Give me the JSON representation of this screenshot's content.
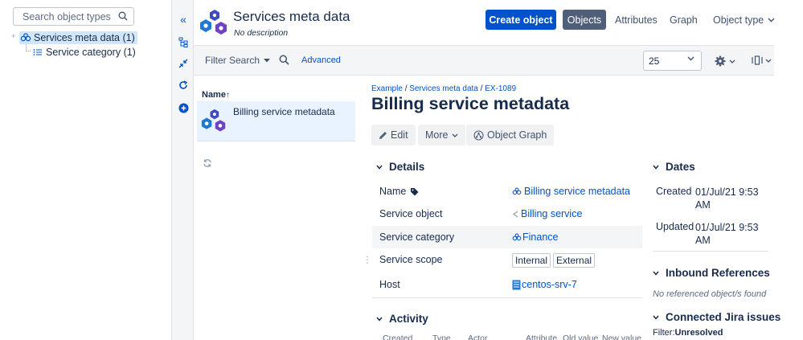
{
  "tree": {
    "search_placeholder": "Search object types",
    "nodes": [
      {
        "label": "Services meta data (1)"
      },
      {
        "label": "Service category (1)"
      }
    ]
  },
  "header": {
    "title": "Services meta data",
    "subtitle": "No description",
    "create_button": "Create object",
    "tabs": [
      "Objects",
      "Attributes",
      "Graph",
      "Object type"
    ]
  },
  "toolbar": {
    "filter_search": "Filter Search",
    "advanced": "Advanced",
    "page_size": "25"
  },
  "list": {
    "column": "Name",
    "rows": [
      {
        "label": "Billing service metadata"
      }
    ]
  },
  "detail": {
    "breadcrumb": [
      "Example",
      "Services meta data",
      "EX-1089"
    ],
    "title": "Billing service metadata",
    "actions": {
      "edit": "Edit",
      "more": "More",
      "graph": "Object Graph"
    },
    "details_heading": "Details",
    "attributes": [
      {
        "key": "Name",
        "value": "Billing service metadata"
      },
      {
        "key": "Service object",
        "value": "Billing service"
      },
      {
        "key": "Service category",
        "value": "Finance"
      },
      {
        "key": "Service scope",
        "values": [
          "Internal",
          "External"
        ]
      },
      {
        "key": "Host",
        "value": "centos-srv-7"
      }
    ],
    "activity_heading": "Activity",
    "activity_columns": [
      "Created",
      "Type",
      "Actor",
      "Attribute",
      "Old value",
      "New value"
    ]
  },
  "side": {
    "dates_heading": "Dates",
    "created_label": "Created",
    "created_value": "01/Jul/21 9:53 AM",
    "updated_label": "Updated",
    "updated_value": "01/Jul/21 9:53 AM",
    "inbound_heading": "Inbound References",
    "inbound_empty": "No referenced object/s found",
    "jira_heading": "Connected Jira issues",
    "filter_label": "Filter:",
    "filter_value": "Unresolved"
  },
  "colors": {
    "primary": "#0052cc",
    "selected_tab": "#505f79",
    "selected_row": "#e9f2ff"
  },
  "icons": [
    "search-icon",
    "services-meta-icon",
    "collapse-icon",
    "hierarchy-icon",
    "expand-icon",
    "refresh-icon",
    "add-icon",
    "settings-icon",
    "view-icon",
    "tag-icon",
    "edit-icon",
    "graph-icon",
    "chevron-down-icon",
    "sort-up-icon",
    "host-icon",
    "reference-icon",
    "finance-icon"
  ]
}
